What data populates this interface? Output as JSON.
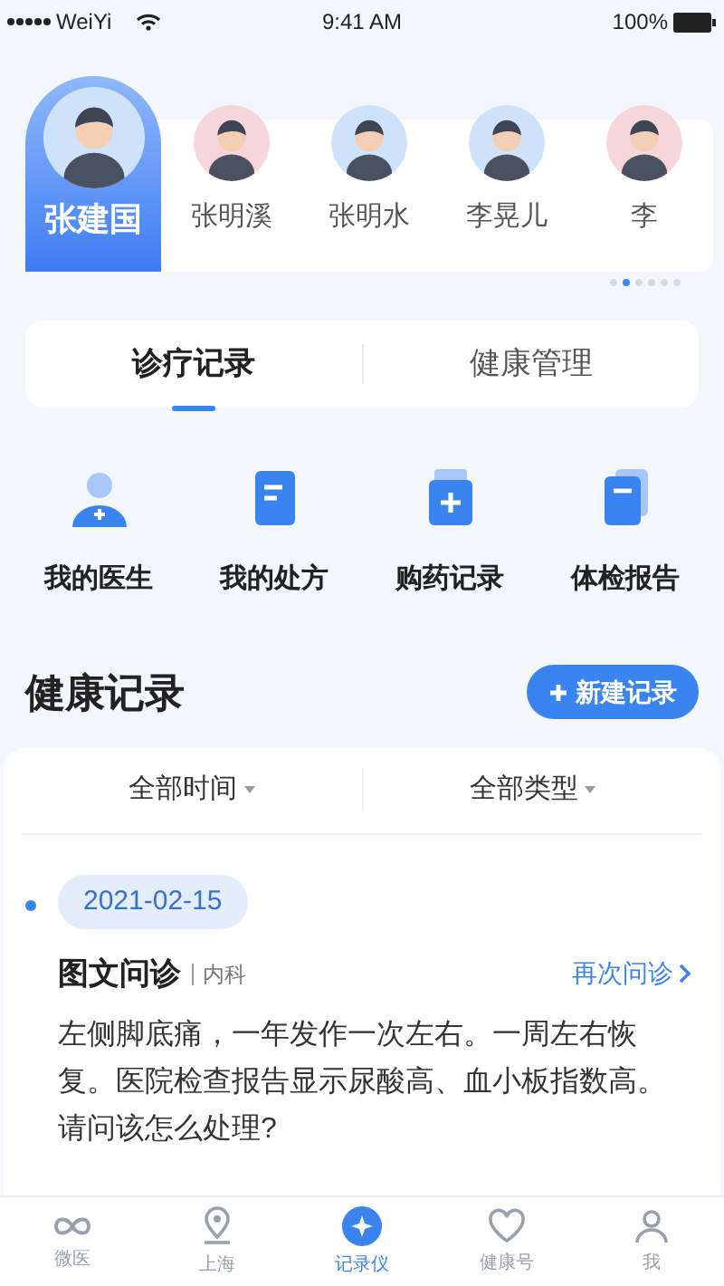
{
  "status_bar": {
    "carrier": "WeiYi",
    "time": "9:41 AM",
    "battery": "100%"
  },
  "members": [
    {
      "name": "张建国",
      "selected": true,
      "color": "#cfe2fb"
    },
    {
      "name": "张明溪",
      "selected": false,
      "color": "#f6d6da"
    },
    {
      "name": "张明水",
      "selected": false,
      "color": "#cfe2fb"
    },
    {
      "name": "李晃儿",
      "selected": false,
      "color": "#cfe2fb"
    },
    {
      "name": "李",
      "selected": false,
      "color": "#f6d6da"
    }
  ],
  "pager": [
    {
      "selected": false
    },
    {
      "selected": true
    },
    {
      "selected": false
    },
    {
      "selected": false
    },
    {
      "selected": false
    },
    {
      "selected": false
    }
  ],
  "tabs": [
    {
      "label": "诊疗记录",
      "selected": true
    },
    {
      "label": "健康管理",
      "selected": false
    }
  ],
  "shortcuts": [
    {
      "label": "我的医生",
      "kind": "doctor"
    },
    {
      "label": "我的处方",
      "kind": "prescription"
    },
    {
      "label": "购药记录",
      "kind": "medicine"
    },
    {
      "label": "体检报告",
      "kind": "report"
    }
  ],
  "section": {
    "title": "健康记录",
    "button": "新建记录"
  },
  "filters": [
    "全部时间",
    "全部类型"
  ],
  "records": [
    {
      "date": "2021-02-15",
      "type": "图文问诊",
      "department": "内科",
      "action": "再次问诊",
      "text": "左侧脚底痛，一年发作一次左右。一周左右恢复。医院检查报告显示尿酸高、血小板指数高。请问该怎么处理?"
    }
  ],
  "nav": [
    {
      "label": "微医",
      "kind": "infinity",
      "selected": false
    },
    {
      "label": "上海",
      "kind": "pin",
      "selected": false
    },
    {
      "label": "记录仪",
      "kind": "record",
      "selected": true
    },
    {
      "label": "健康号",
      "kind": "health",
      "selected": false
    },
    {
      "label": "我",
      "kind": "me",
      "selected": false
    }
  ]
}
